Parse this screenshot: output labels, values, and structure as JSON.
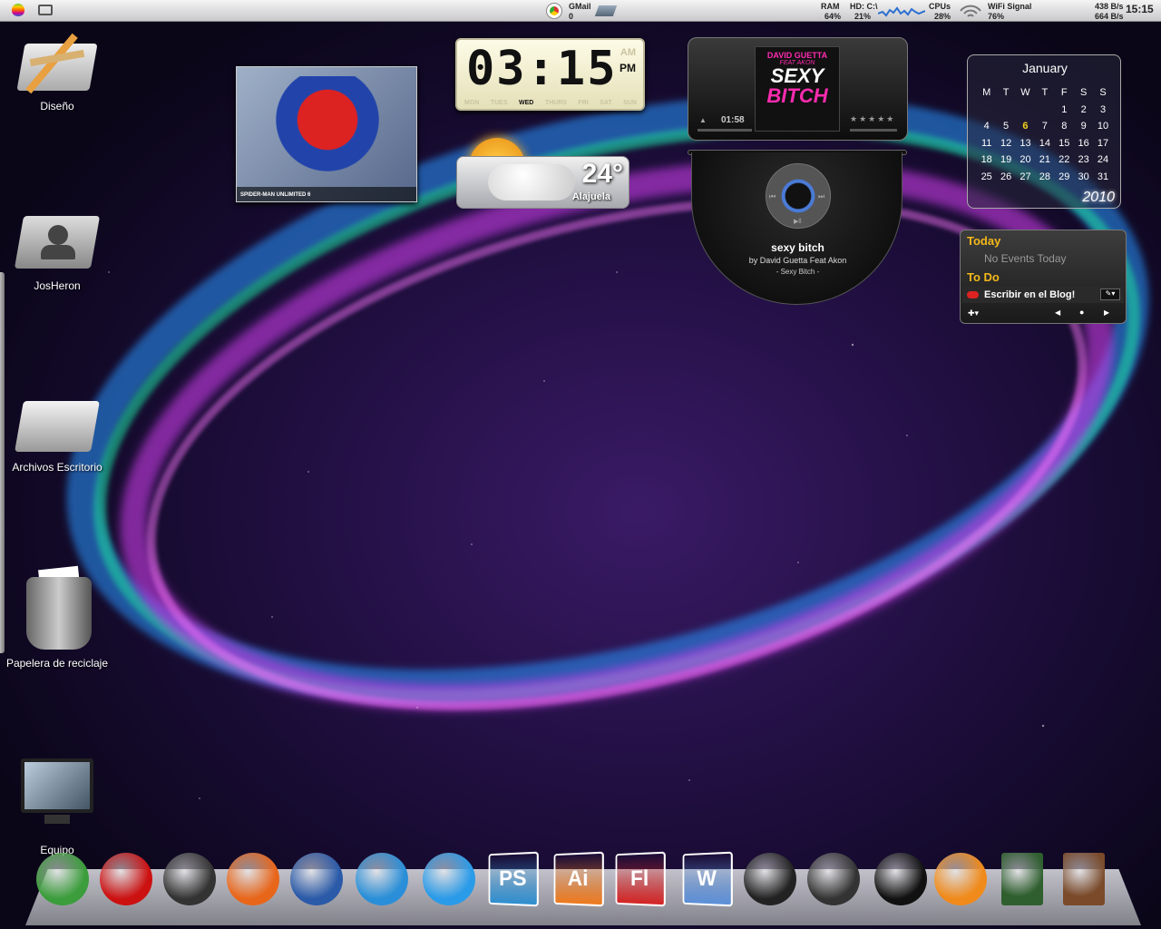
{
  "topbar": {
    "gmail_label": "GMail",
    "gmail_count": "0",
    "ram_label": "RAM",
    "ram_value": "64%",
    "hd_label": "HD: C:\\",
    "hd_value": "21%",
    "cpu_label": "CPUs",
    "cpu_value": "28%",
    "wifi_label": "WiFi Signal",
    "wifi_value": "76%",
    "net_down": "438 B/s",
    "net_up": "664 B/s",
    "time": "15:15"
  },
  "desktop_icons": [
    {
      "label": "Diseño",
      "icon": "design-folder-icon"
    },
    {
      "label": "JosHeron",
      "icon": "user-folder-icon"
    },
    {
      "label": "Archivos Escritorio",
      "icon": "folder-icon"
    },
    {
      "label": "Papelera de reciclaje",
      "icon": "trash-icon"
    },
    {
      "label": "Equipo",
      "icon": "monitor-icon"
    }
  ],
  "photo_widget": {
    "caption": "SPIDER-MAN UNLIMITED 6"
  },
  "clock": {
    "digits": "03:15",
    "ampm_am": "AM",
    "ampm_pm": "PM",
    "days": [
      "MON",
      "TUES",
      "WED",
      "THURS",
      "FRI",
      "SAT",
      "SUN"
    ],
    "active_day": "WED"
  },
  "weather": {
    "temp": "24°",
    "city": "Alajuela"
  },
  "player": {
    "album_line1": "DAVID GUETTA",
    "album_line2": "FEAT AKON",
    "album_title1": "SEXY",
    "album_title2": "BITCH",
    "elapsed": "01:58",
    "rating": "★★★★★",
    "track": "sexy bitch",
    "artist": "by David Guetta Feat Akon",
    "album": "- Sexy Bitch -"
  },
  "calendar": {
    "month": "January",
    "year": "2010",
    "weekdays": [
      "M",
      "T",
      "W",
      "T",
      "F",
      "S",
      "S"
    ],
    "rows": [
      [
        "",
        "",
        "",
        "",
        "1",
        "2",
        "3"
      ],
      [
        "4",
        "5",
        "6",
        "7",
        "8",
        "9",
        "10"
      ],
      [
        "11",
        "12",
        "13",
        "14",
        "15",
        "16",
        "17"
      ],
      [
        "18",
        "19",
        "20",
        "21",
        "22",
        "23",
        "24"
      ],
      [
        "25",
        "26",
        "27",
        "28",
        "29",
        "30",
        "31"
      ]
    ],
    "today": "6"
  },
  "todo": {
    "today_label": "Today",
    "no_events": "No Events Today",
    "todo_label": "To Do",
    "task": "Escribir en el Blog!"
  },
  "dock": [
    {
      "name": "chrome-icon",
      "color": "#3b9d3b"
    },
    {
      "name": "opera-icon",
      "color": "#cc1111"
    },
    {
      "name": "safari-icon",
      "color": "#333"
    },
    {
      "name": "firefox-icon",
      "color": "#e8661a"
    },
    {
      "name": "thunderbird-icon",
      "color": "#2a5aa8"
    },
    {
      "name": "network-globe-icon",
      "color": "#2a8fd8"
    },
    {
      "name": "messenger-icon",
      "color": "#2a9be8"
    },
    {
      "name": "photoshop-icon",
      "color": "#2f8fd0",
      "text": "PS"
    },
    {
      "name": "illustrator-icon",
      "color": "#ee7a1e",
      "text": "Ai"
    },
    {
      "name": "flash-icon",
      "color": "#d42424",
      "text": "Fl"
    },
    {
      "name": "word-icon",
      "color": "#5b8fd8",
      "text": "W"
    },
    {
      "name": "tablet-icon",
      "color": "#222"
    },
    {
      "name": "headphones-icon",
      "color": "#333"
    },
    {
      "name": "zune-icon",
      "color": "#111"
    },
    {
      "name": "avast-icon",
      "color": "#f08a1a"
    },
    {
      "name": "pes-game-icon",
      "color": "#2f5f2f"
    },
    {
      "name": "war-game-icon",
      "color": "#7a4a2a"
    }
  ]
}
